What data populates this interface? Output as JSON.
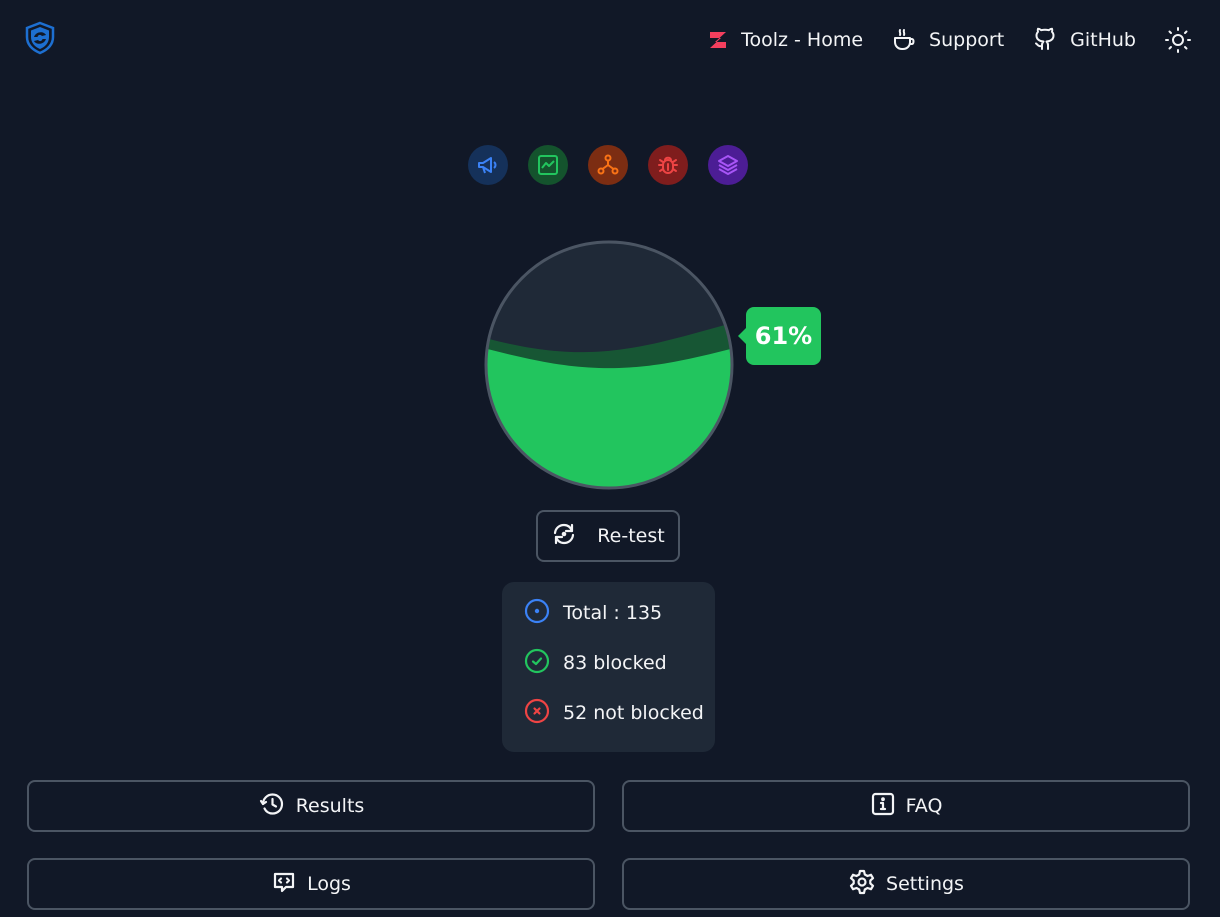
{
  "nav": {
    "home_label": "Toolz - Home",
    "support_label": "Support",
    "github_label": "GitHub",
    "theme_icon": "sun-icon"
  },
  "categories": [
    {
      "icon": "megaphone-icon",
      "color": "#3b82f6"
    },
    {
      "icon": "chart-icon",
      "color": "#22c55e"
    },
    {
      "icon": "network-icon",
      "color": "#f97316"
    },
    {
      "icon": "bug-icon",
      "color": "#ef4444"
    },
    {
      "icon": "layers-icon",
      "color": "#a855f7"
    }
  ],
  "score": {
    "percent_label": "61%",
    "fill_fraction": 0.61,
    "fill_color": "#22c55e"
  },
  "retest_label": "Re-test",
  "stats": {
    "total_label": "Total : 135",
    "blocked_label": "83 blocked",
    "not_blocked_label": "52 not blocked",
    "colors": {
      "total": "#3b82f6",
      "blocked": "#22c55e",
      "not_blocked": "#ef4444"
    }
  },
  "actions": {
    "results_label": "Results",
    "faq_label": "FAQ",
    "logs_label": "Logs",
    "settings_label": "Settings"
  }
}
